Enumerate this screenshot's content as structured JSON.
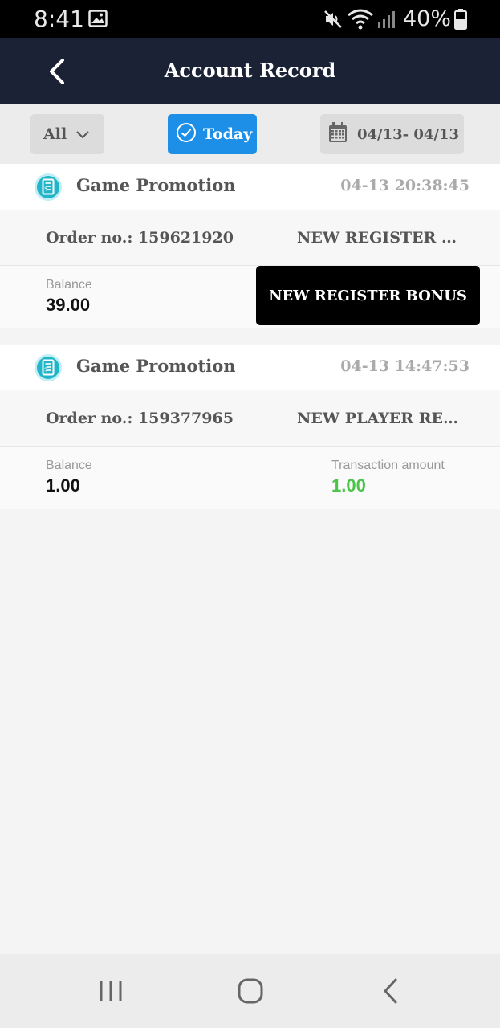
{
  "status_bar": {
    "time": "8:41",
    "battery": "40%",
    "icons": [
      "image-icon",
      "mute-icon",
      "wifi-icon",
      "signal-icon",
      "battery-icon"
    ]
  },
  "header": {
    "title": "Account Record",
    "back_icon": "chevron-left-icon"
  },
  "filters": {
    "type_label": "All",
    "today_label": "Today",
    "date_range": "04/13- 04/13",
    "accent": "#1e8fe6"
  },
  "records": [
    {
      "type": "Game Promotion",
      "time": "04-13 20:38:45",
      "order_label": "Order no.: 159621920",
      "description": "NEW REGISTER BO...",
      "balance_label": "Balance",
      "balance": "39.00",
      "amount_label": "",
      "amount": ""
    },
    {
      "type": "Game Promotion",
      "time": "04-13 14:47:53",
      "order_label": "Order no.: 159377965",
      "description": "NEW PLAYER RED ...",
      "balance_label": "Balance",
      "balance": "1.00",
      "amount_label": "Transaction amount",
      "amount": "1.00"
    }
  ],
  "tooltip": {
    "text": "NEW REGISTER BONUS"
  },
  "nav": {
    "icons": [
      "recent-apps-icon",
      "home-icon",
      "back-icon"
    ]
  },
  "colors": {
    "header_bg": "#1b2236",
    "amount_positive": "#4cc44a"
  }
}
